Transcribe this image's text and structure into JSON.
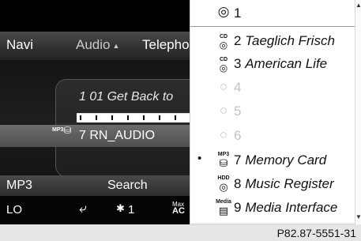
{
  "screen": {
    "nav_tabs": [
      {
        "label": "Navi",
        "active": false
      },
      {
        "label": "Audio",
        "active": true
      },
      {
        "label": "Telephone",
        "active": false
      }
    ],
    "track_title": "1 01 Get Back to",
    "progress_fraction": 0.05,
    "source": {
      "icon_text": "MP3",
      "label": "7 RN_AUDIO"
    },
    "softkeys": [
      {
        "label": "MP3"
      },
      {
        "label": "Search"
      }
    ],
    "climate": {
      "left_temp": "LO",
      "fan_level": "1",
      "max_label": "Max",
      "max_sub": "AC"
    }
  },
  "dropdown": {
    "items": [
      {
        "number": "1",
        "name": "",
        "icon": "radio-button-icon",
        "icon_text": "",
        "enabled": true,
        "current": false
      },
      {
        "number": "2",
        "name": "Taeglich Frisch",
        "icon": "cd-icon",
        "icon_text": "CD",
        "enabled": true,
        "current": false
      },
      {
        "number": "3",
        "name": "American Life",
        "icon": "cd-icon",
        "icon_text": "CD",
        "enabled": true,
        "current": false
      },
      {
        "number": "4",
        "name": "",
        "icon": "empty-slot-icon",
        "icon_text": "",
        "enabled": false,
        "current": false
      },
      {
        "number": "5",
        "name": "",
        "icon": "empty-slot-icon",
        "icon_text": "",
        "enabled": false,
        "current": false
      },
      {
        "number": "6",
        "name": "",
        "icon": "empty-slot-icon",
        "icon_text": "",
        "enabled": false,
        "current": false
      },
      {
        "number": "7",
        "name": "Memory Card",
        "icon": "mp3-card-icon",
        "icon_text": "MP3",
        "enabled": true,
        "current": true
      },
      {
        "number": "8",
        "name": "Music Register",
        "icon": "hdd-icon",
        "icon_text": "HDD",
        "enabled": true,
        "current": false
      },
      {
        "number": "9",
        "name": "Media Interface",
        "icon": "media-icon",
        "icon_text": "Media",
        "enabled": true,
        "current": false
      }
    ]
  },
  "footer": {
    "reference": "P82.87-5551-31"
  },
  "colors": {
    "screen_bg": "#0a0a0a",
    "list_bg": "#ffffff",
    "disabled_text": "#c2c2c2"
  }
}
